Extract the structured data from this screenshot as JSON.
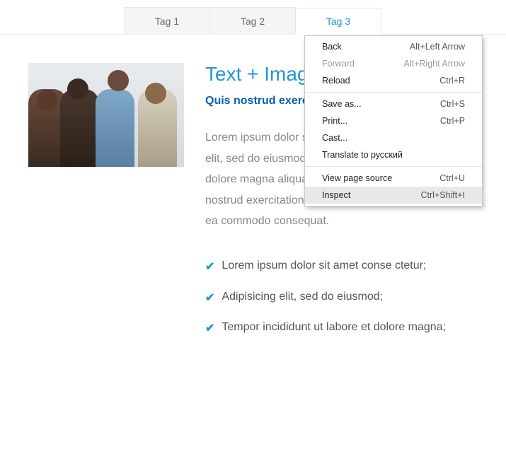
{
  "tabs": [
    {
      "label": "Tag 1",
      "active": false
    },
    {
      "label": "Tag 2",
      "active": false
    },
    {
      "label": "Tag 3",
      "active": true
    }
  ],
  "heading": "Text + Image",
  "subheading": "Quis nostrud exercitation ullamco.",
  "paragraph": "Lorem ipsum dolor sit amet, consectetur adipisicing elit, sed do eiusmod tempor incididunt ut labore et dolore magna aliqua. Ut enim ad minim veniam, quis nostrud exercitation ullamco laboris nisi ut aliquip ex ea commodo consequat.",
  "list": [
    "Lorem ipsum dolor sit amet conse ctetur;",
    "Adipisicing elit, sed do eiusmod;",
    "Tempor incididunt ut labore et dolore magna;"
  ],
  "context_menu": [
    {
      "label": "Back",
      "shortcut": "Alt+Left Arrow",
      "disabled": false
    },
    {
      "label": "Forward",
      "shortcut": "Alt+Right Arrow",
      "disabled": true
    },
    {
      "label": "Reload",
      "shortcut": "Ctrl+R",
      "disabled": false
    },
    {
      "sep": true
    },
    {
      "label": "Save as...",
      "shortcut": "Ctrl+S",
      "disabled": false
    },
    {
      "label": "Print...",
      "shortcut": "Ctrl+P",
      "disabled": false
    },
    {
      "label": "Cast...",
      "shortcut": "",
      "disabled": false
    },
    {
      "label": "Translate to русский",
      "shortcut": "",
      "disabled": false
    },
    {
      "sep": true
    },
    {
      "label": "View page source",
      "shortcut": "Ctrl+U",
      "disabled": false
    },
    {
      "label": "Inspect",
      "shortcut": "Ctrl+Shift+I",
      "disabled": false,
      "highlight": true
    }
  ]
}
